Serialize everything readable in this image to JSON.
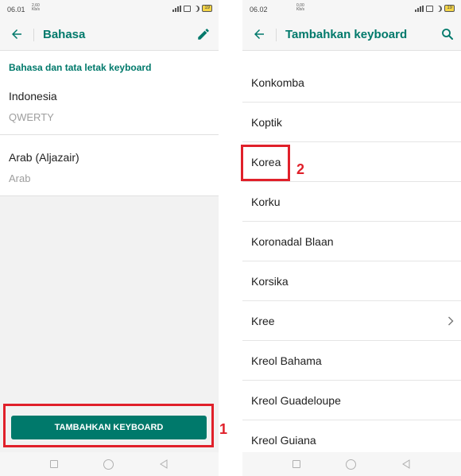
{
  "left_screen": {
    "status": {
      "time": "06.01",
      "net_speed_top": "2,60",
      "net_speed_bottom": "Kb/s",
      "battery": "19"
    },
    "app_bar": {
      "title": "Bahasa",
      "back_icon": "arrow-left-icon",
      "edit_icon": "pencil-icon"
    },
    "section_header": "Bahasa dan tata letak keyboard",
    "languages": [
      {
        "name": "Indonesia",
        "layout": "QWERTY"
      },
      {
        "name": "Arab (Aljazair)",
        "layout": "Arab"
      }
    ],
    "add_button_label": "TAMBAHKAN KEYBOARD",
    "annotation": "1"
  },
  "right_screen": {
    "status": {
      "time": "06.02",
      "net_speed_top": "0,00",
      "net_speed_bottom": "Kb/s",
      "battery": "19"
    },
    "app_bar": {
      "title": "Tambahkan keyboard",
      "back_icon": "arrow-left-icon",
      "search_icon": "search-icon"
    },
    "keyboards": [
      {
        "label": "Konkomba"
      },
      {
        "label": "Koptik"
      },
      {
        "label": "Korea"
      },
      {
        "label": "Korku"
      },
      {
        "label": "Koronadal Blaan"
      },
      {
        "label": "Korsika"
      },
      {
        "label": "Kree",
        "has_submenu": true
      },
      {
        "label": "Kreol Bahama"
      },
      {
        "label": "Kreol Guadeloupe"
      },
      {
        "label": "Kreol Guiana"
      }
    ],
    "annotation": "2"
  },
  "colors": {
    "accent": "#00796b",
    "highlight": "#e0202a"
  }
}
